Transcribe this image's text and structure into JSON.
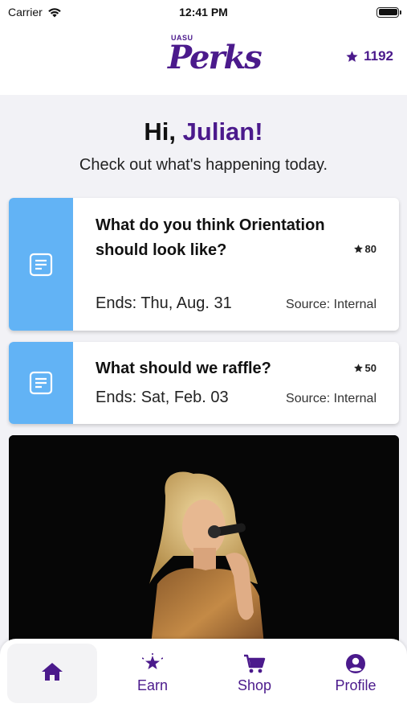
{
  "status_bar": {
    "carrier": "Carrier",
    "time": "12:41 PM"
  },
  "header": {
    "logo_small": "UASU",
    "logo_main": "Perks",
    "points": "1192"
  },
  "greeting": {
    "prefix": "Hi, ",
    "name": "Julian!",
    "subtitle": "Check out what's happening today."
  },
  "cards": [
    {
      "title": "What do you think Orientation should look like?",
      "reward": "80",
      "ends": "Ends: Thu, Aug. 31",
      "source": "Source: Internal",
      "icon": "document-icon"
    },
    {
      "title": "What should we raffle?",
      "reward": "50",
      "ends": "Ends: Sat, Feb. 03",
      "source": "Source: Internal",
      "icon": "document-icon"
    }
  ],
  "tabs": [
    {
      "label": "",
      "icon": "home-icon",
      "active": true
    },
    {
      "label": "Earn",
      "icon": "earn-icon",
      "active": false
    },
    {
      "label": "Shop",
      "icon": "cart-icon",
      "active": false
    },
    {
      "label": "Profile",
      "icon": "profile-icon",
      "active": false
    }
  ],
  "colors": {
    "brand_purple": "#4b1a8c",
    "card_strip_blue": "#62b3f5",
    "background": "#f2f2f6"
  }
}
